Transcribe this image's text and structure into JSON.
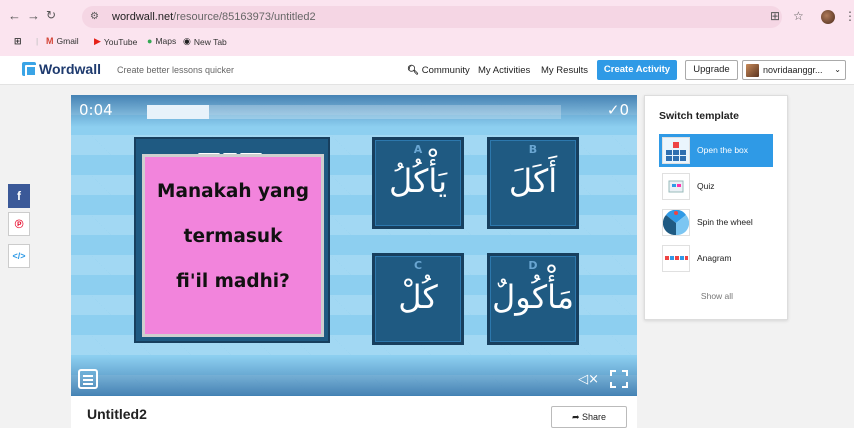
{
  "browser": {
    "url_host": "wordwall.net",
    "url_path": "/resource/85163973/untitled2",
    "bookmarks": [
      {
        "label": "Gmail",
        "icon": "gmail-icon"
      },
      {
        "label": "YouTube",
        "icon": "youtube-icon"
      },
      {
        "label": "Maps",
        "icon": "maps-icon"
      },
      {
        "label": "New Tab",
        "icon": "new-tab-icon"
      }
    ]
  },
  "header": {
    "logo": "Wordwall",
    "tagline": "Create better lessons quicker",
    "community": "Community",
    "my_activities": "My Activities",
    "my_results": "My Results",
    "create_activity": "Create Activity",
    "upgrade": "Upgrade",
    "username": "novridaanggr..."
  },
  "game": {
    "timer": "0:04",
    "score": "✓0",
    "progress_fraction": 0.15,
    "question": [
      "Manakah yang",
      "termasuk",
      "fi'il madhi?"
    ],
    "options": [
      {
        "letter": "A",
        "text": "يَأْكُلُ"
      },
      {
        "letter": "B",
        "text": "أَكَلَ"
      },
      {
        "letter": "C",
        "text": "كُلْ"
      },
      {
        "letter": "D",
        "text": "مَأْكُولٌ"
      }
    ],
    "colors": {
      "box": "#1f5a82",
      "question_bg": "#f284dc",
      "stage": "#8dcff0"
    }
  },
  "switch_template": {
    "title": "Switch template",
    "items": [
      {
        "label": "Open the box",
        "active": true
      },
      {
        "label": "Quiz",
        "active": false
      },
      {
        "label": "Spin the wheel",
        "active": false
      },
      {
        "label": "Anagram",
        "active": false
      }
    ],
    "show_all": "Show all"
  },
  "activity": {
    "title": "Untitled2",
    "share": "Share"
  }
}
